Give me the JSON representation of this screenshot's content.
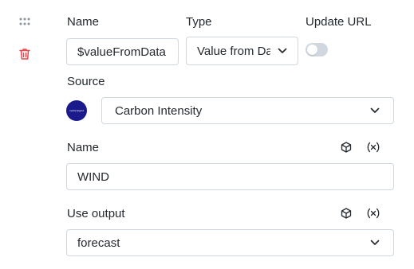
{
  "variable": {
    "name_label": "Name",
    "type_label": "Type",
    "update_url_label": "Update URL",
    "name_value": "$valueFromData",
    "type_value": "Value from Da",
    "update_url_enabled": false
  },
  "source": {
    "label": "Source",
    "logo_text": "nationalgrid",
    "selected": "Carbon Intensity"
  },
  "params": {
    "name_label": "Name",
    "name_value": "WIND",
    "output_label": "Use output",
    "output_value": "forecast"
  },
  "icons": {
    "drag": "drag-handle-icon",
    "delete": "trash-icon",
    "cube": "cube-icon",
    "variable": "variable-x-icon",
    "chevron": "chevron-down-icon"
  },
  "colors": {
    "delete": "#e5484d",
    "toggle_off": "#d0d7de",
    "logo_bg": "#1a1a8c"
  }
}
